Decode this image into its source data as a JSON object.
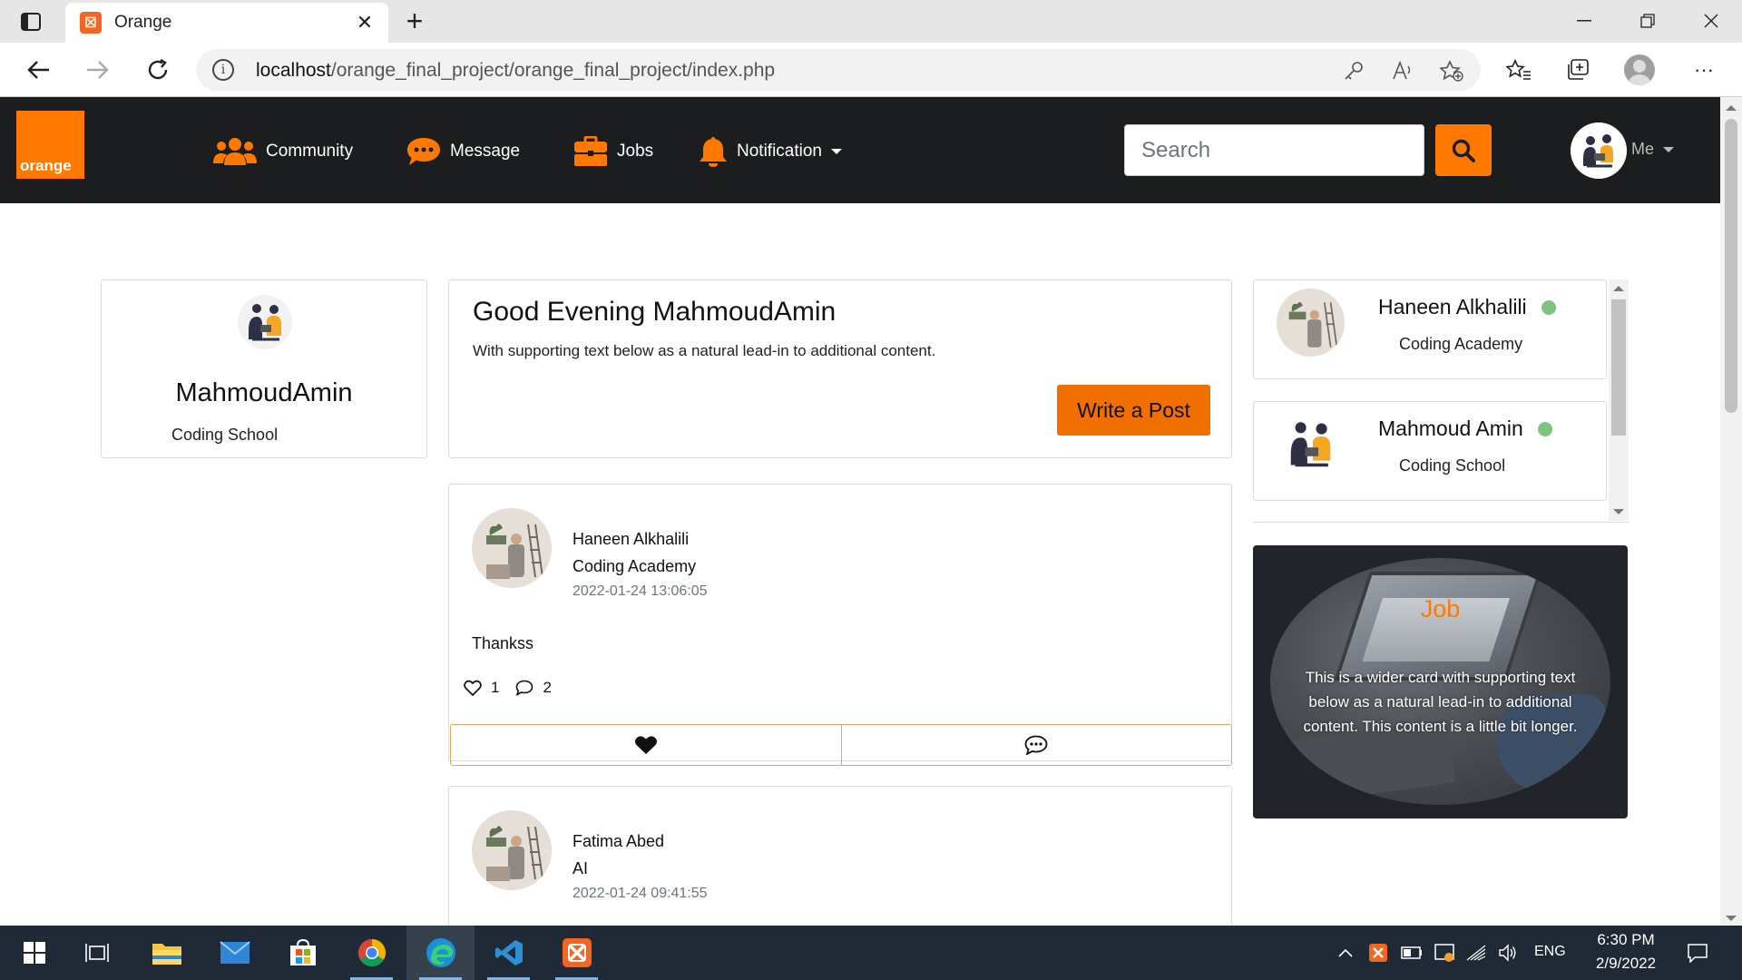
{
  "browser": {
    "tab_title": "Orange",
    "favicon_glyph": "☒",
    "url_host": "localhost",
    "url_path": "/orange_final_project/orange_final_project/index.php"
  },
  "navbar": {
    "logo_text": "orange",
    "items": [
      {
        "label": "Community",
        "icon": "users-icon"
      },
      {
        "label": "Message",
        "icon": "chat-icon"
      },
      {
        "label": "Jobs",
        "icon": "briefcase-icon"
      },
      {
        "label": "Notification",
        "icon": "bell-icon"
      }
    ],
    "search_placeholder": "Search",
    "me_label": "Me",
    "accent": "#ff7900"
  },
  "profile": {
    "name": "MahmoudAmin",
    "org": "Coding School"
  },
  "greeting": {
    "title": "Good Evening MahmoudAmin",
    "text": "With supporting text below as a natural lead-in to additional content.",
    "write_button": "Write a Post"
  },
  "posts": [
    {
      "author": "Haneen Alkhalili",
      "org": "Coding Academy",
      "date": "2022-01-24 13:06:05",
      "text": "Thankss",
      "likes": "1",
      "comments": "2"
    },
    {
      "author": "Fatima Abed",
      "org": "AI",
      "date": "2022-01-24 09:41:55"
    }
  ],
  "friends": [
    {
      "name": "Haneen Alkhalili",
      "org": "Coding Academy",
      "status": "online"
    },
    {
      "name": "Mahmoud Amin",
      "org": "Coding School",
      "status": "online"
    }
  ],
  "job_card": {
    "title": "Job",
    "text": "This is a wider card with supporting text below as a natural lead-in to additional content. This content is a little bit longer."
  },
  "taskbar": {
    "lang": "ENG",
    "time": "6:30 PM",
    "date": "2/9/2022"
  }
}
